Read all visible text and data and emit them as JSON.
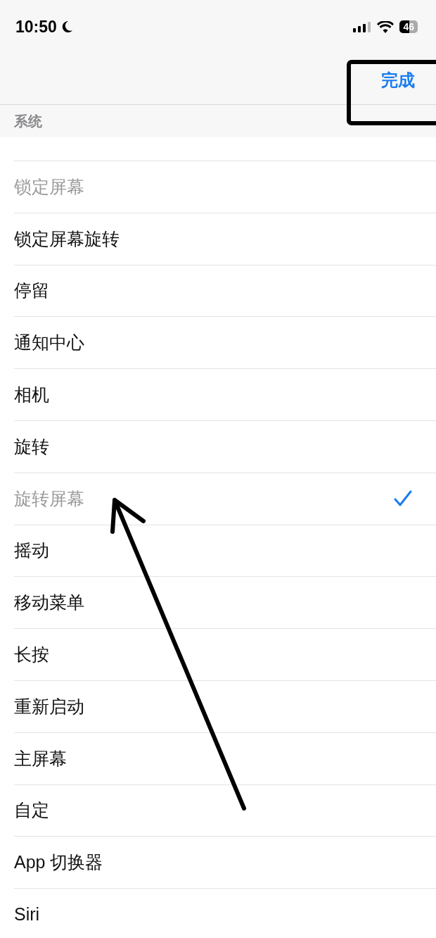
{
  "status_bar": {
    "time": "10:50",
    "battery": "46"
  },
  "nav": {
    "done": "完成"
  },
  "section": {
    "title": "系统"
  },
  "items": [
    {
      "label": "锁定屏幕",
      "disabled": true,
      "selected": false
    },
    {
      "label": "锁定屏幕旋转",
      "disabled": false,
      "selected": false
    },
    {
      "label": "停留",
      "disabled": false,
      "selected": false
    },
    {
      "label": "通知中心",
      "disabled": false,
      "selected": false
    },
    {
      "label": "相机",
      "disabled": false,
      "selected": false
    },
    {
      "label": "旋转",
      "disabled": false,
      "selected": false
    },
    {
      "label": "旋转屏幕",
      "disabled": true,
      "selected": true
    },
    {
      "label": "摇动",
      "disabled": false,
      "selected": false
    },
    {
      "label": "移动菜单",
      "disabled": false,
      "selected": false
    },
    {
      "label": "长按",
      "disabled": false,
      "selected": false
    },
    {
      "label": "重新启动",
      "disabled": false,
      "selected": false
    },
    {
      "label": "主屏幕",
      "disabled": false,
      "selected": false
    },
    {
      "label": "自定",
      "disabled": false,
      "selected": false
    },
    {
      "label": "App 切换器",
      "disabled": false,
      "selected": false
    },
    {
      "label": "Siri",
      "disabled": false,
      "selected": false
    }
  ]
}
